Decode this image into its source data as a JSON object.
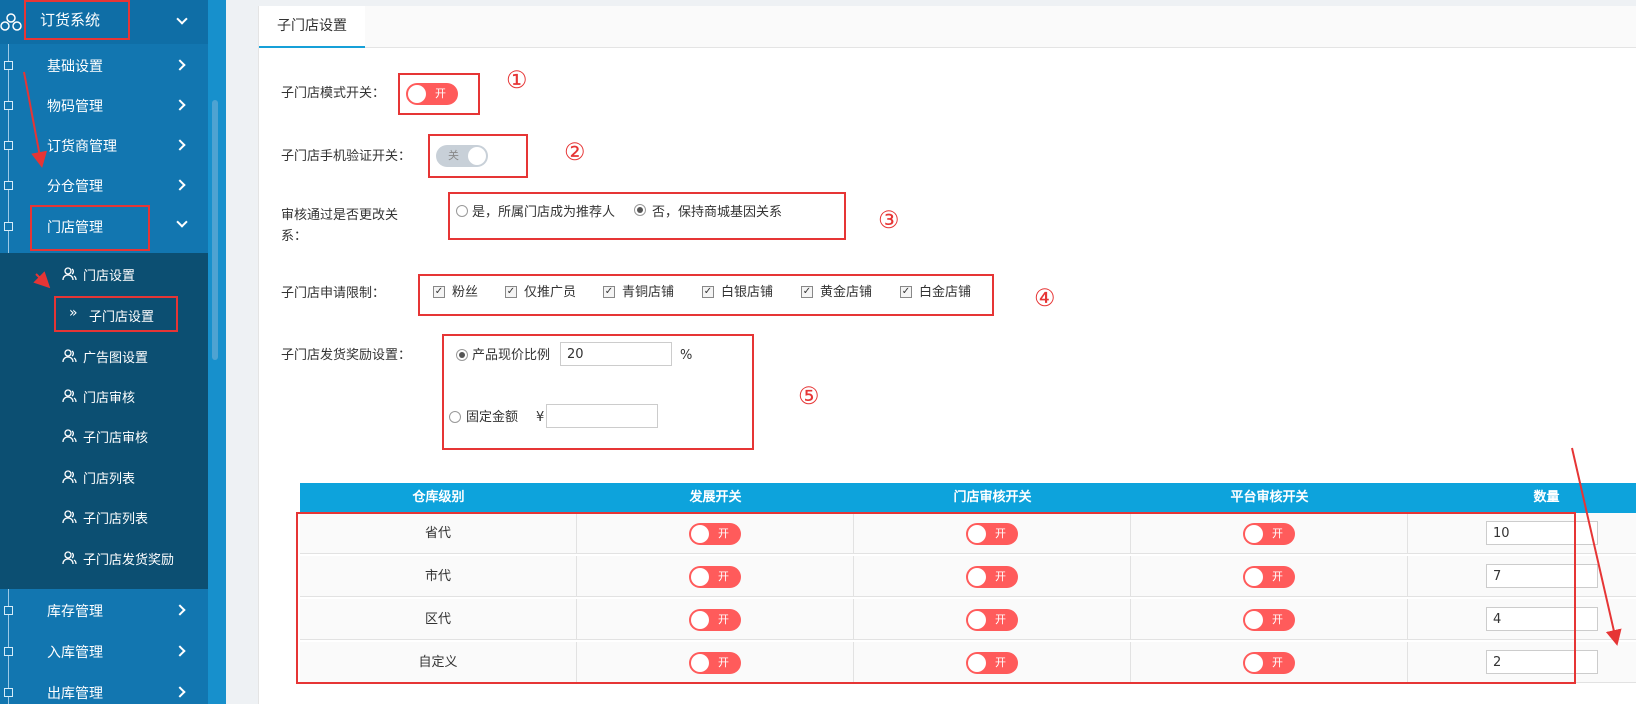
{
  "sidebar": {
    "top_label": "订货系统",
    "items": [
      {
        "label": "基础设置"
      },
      {
        "label": "物码管理"
      },
      {
        "label": "订货商管理"
      },
      {
        "label": "分仓管理"
      },
      {
        "label": "门店管理"
      }
    ],
    "sub_items": [
      {
        "label": "门店设置"
      },
      {
        "label": "子门店设置"
      },
      {
        "label": "广告图设置"
      },
      {
        "label": "门店审核"
      },
      {
        "label": "子门店审核"
      },
      {
        "label": "门店列表"
      },
      {
        "label": "子门店列表"
      },
      {
        "label": "子门店发货奖励"
      }
    ],
    "bottom_items": [
      {
        "label": "库存管理"
      },
      {
        "label": "入库管理"
      },
      {
        "label": "出库管理"
      }
    ]
  },
  "tabs": {
    "active": "子门店设置"
  },
  "form": {
    "mode_switch_label": "子门店模式开关：",
    "mode_switch_state": "开",
    "phone_switch_label": "子门店手机验证开关：",
    "phone_switch_state": "关",
    "review_label_1": "审核通过是否更改关",
    "review_label_2": "系：",
    "review_opt_yes": "是，所属门店成为推荐人",
    "review_opt_no": "否，保持商城基因关系",
    "limit_label": "子门店申请限制：",
    "limit_options": [
      "粉丝",
      "仅推广员",
      "青铜店铺",
      "白银店铺",
      "黄金店铺",
      "白金店铺"
    ],
    "reward_label": "子门店发货奖励设置：",
    "reward_ratio_label": "产品现价比例",
    "reward_ratio_value": "20",
    "reward_ratio_unit": "%",
    "reward_fixed_label": "固定金额",
    "reward_fixed_currency": "¥",
    "reward_fixed_value": ""
  },
  "annotations": [
    "①",
    "②",
    "③",
    "④",
    "⑤"
  ],
  "table": {
    "headers": [
      "仓库级别",
      "发展开关",
      "门店审核开关",
      "平台审核开关",
      "数量"
    ],
    "rows": [
      {
        "level": "省代",
        "dev": "开",
        "store": "开",
        "platform": "开",
        "qty": "10"
      },
      {
        "level": "市代",
        "dev": "开",
        "store": "开",
        "platform": "开",
        "qty": "7"
      },
      {
        "level": "区代",
        "dev": "开",
        "store": "开",
        "platform": "开",
        "qty": "4"
      },
      {
        "level": "自定义",
        "dev": "开",
        "store": "开",
        "platform": "开",
        "qty": "2"
      }
    ]
  },
  "colors": {
    "accent": "#0da3dc",
    "sidebar": "#1276b0",
    "switch_on": "#ff5b5b",
    "annotation": "#e63535"
  }
}
